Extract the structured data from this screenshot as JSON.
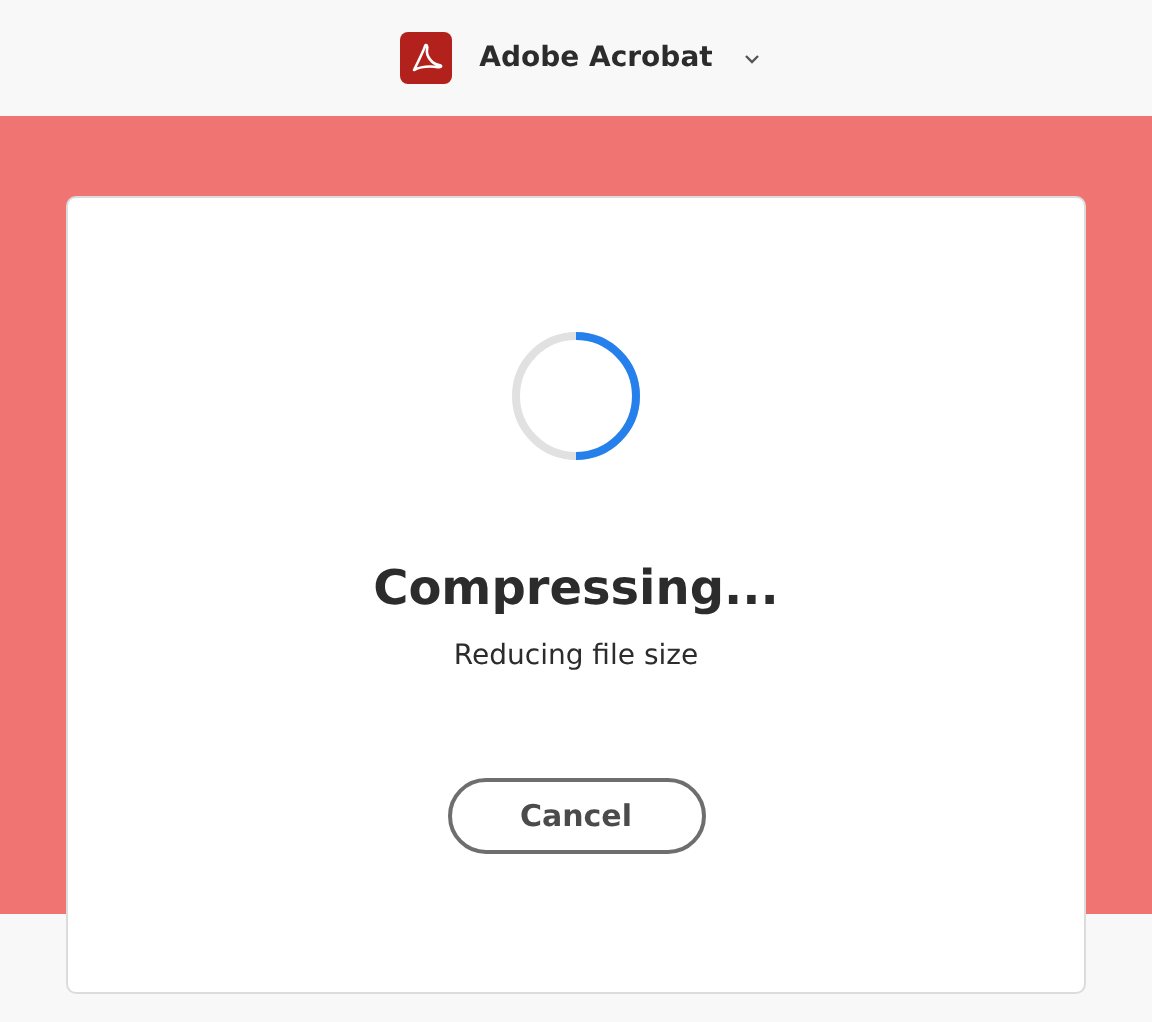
{
  "header": {
    "app_name": "Adobe Acrobat"
  },
  "dialog": {
    "title": "Compressing...",
    "subtitle": "Reducing file size",
    "buttons": [
      "Cancel"
    ]
  }
}
